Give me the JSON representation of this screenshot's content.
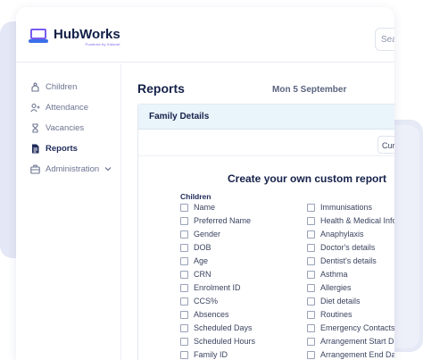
{
  "brand": {
    "name": "HubWorks",
    "tagline": "Powered by Kidsnet"
  },
  "header": {
    "search_placeholder": "Search"
  },
  "sidebar": {
    "items": [
      {
        "label": "Children",
        "icon": "children-icon",
        "active": false
      },
      {
        "label": "Attendance",
        "icon": "attendance-icon",
        "active": false
      },
      {
        "label": "Vacancies",
        "icon": "hourglass-icon",
        "active": false
      },
      {
        "label": "Reports",
        "icon": "document-icon",
        "active": true
      },
      {
        "label": "Administration",
        "icon": "briefcase-icon",
        "active": false,
        "has_submenu": true
      }
    ]
  },
  "main": {
    "title": "Reports",
    "date": "Mon 5 September",
    "panel": {
      "title": "Family Details",
      "dropdown_value": "Cur",
      "report_title": "Create your own custom report",
      "section_label": "Children",
      "left_options": [
        "Name",
        "Preferred Name",
        "Gender",
        "DOB",
        "Age",
        "CRN",
        "Enrolment ID",
        "CCS%",
        "Absences",
        "Scheduled Days",
        "Scheduled Hours",
        "Family ID"
      ],
      "right_options": [
        "Immunisations",
        "Health & Medical Info",
        "Anaphylaxis",
        "Doctor's details",
        "Dentist's details",
        "Asthma",
        "Allergies",
        "Diet details",
        "Routines",
        "Emergency Contacts",
        "Arrangement Start Date",
        "Arrangement End Date"
      ]
    }
  },
  "colors": {
    "accent": "#7a5cf0",
    "brand_blue": "#3b6ee8",
    "panel_header_bg": "#eaf4fb",
    "text_dark": "#15214a"
  }
}
